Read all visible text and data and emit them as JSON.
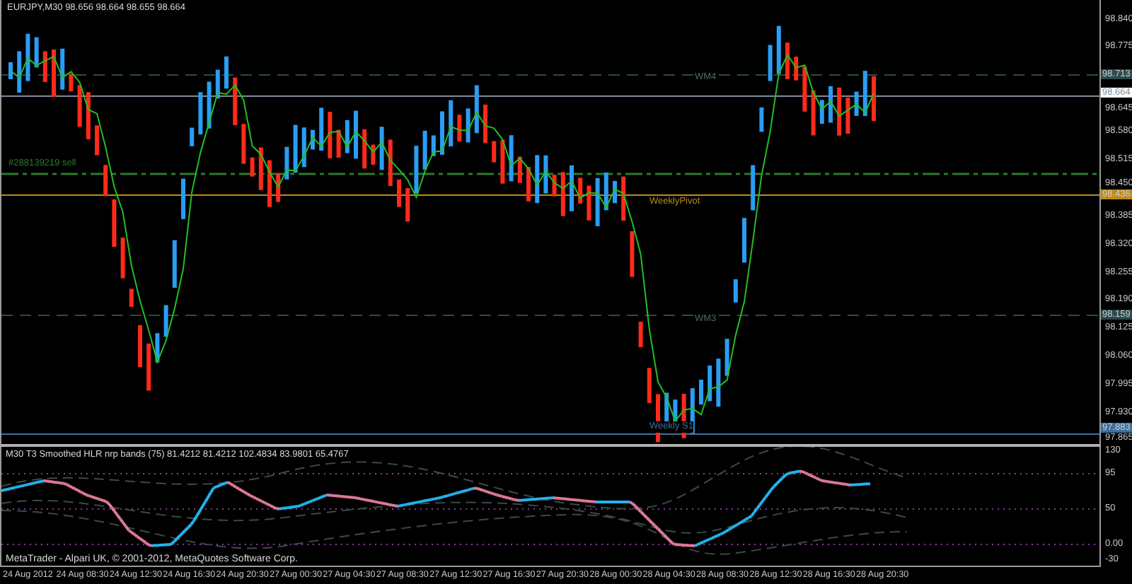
{
  "window": {
    "title": "EURJPY,M30  98.656 98.664 98.655 98.664"
  },
  "main_chart": {
    "levels": [
      {
        "kind": "dashed",
        "label": "WM4",
        "tag": "98.713",
        "color": "#2e4a4a"
      },
      {
        "kind": "solid",
        "tag": "98.664",
        "color": "#7f8c99"
      },
      {
        "kind": "dashdot",
        "label": "#288139219 sell",
        "color": "#2c7a2c"
      },
      {
        "kind": "solid",
        "label": "WeeklyPivot",
        "tag": "98.436",
        "color": "#c08a14"
      },
      {
        "kind": "dashed",
        "label": "WM3",
        "tag": "98.159",
        "color": "#2e4a4a"
      },
      {
        "kind": "solid",
        "label": "Weekly S1",
        "tag": "97.883",
        "color": "#3c6e9e"
      }
    ],
    "price_axis": [
      "98.840",
      "98.775",
      "98.645",
      "98.580",
      "98.515",
      "98.450",
      "98.385",
      "98.320",
      "98.255",
      "98.190",
      "98.125",
      "98.060",
      "97.995",
      "97.930",
      "97.865"
    ]
  },
  "indicator": {
    "title": "M30  T3 Smoothed HLR nrp bands (75) 81.4212 81.4212 102.4834 83.9801 65.4767",
    "axis": [
      "130",
      "95",
      "50",
      "0.00",
      "-30"
    ]
  },
  "copyright": "MetaTrader - Alpari UK, © 2001-2012, MetaQuotes Software Corp.",
  "time_axis": [
    "24 Aug 2012",
    "24 Aug 08:30",
    "24 Aug 12:30",
    "24 Aug 16:30",
    "24 Aug 20:30",
    "27 Aug 00:30",
    "27 Aug 04:30",
    "27 Aug 08:30",
    "27 Aug 12:30",
    "27 Aug 16:30",
    "27 Aug 20:30",
    "28 Aug 00:30",
    "28 Aug 04:30",
    "28 Aug 08:30",
    "28 Aug 12:30",
    "28 Aug 16:30",
    "28 Aug 20:30"
  ]
}
